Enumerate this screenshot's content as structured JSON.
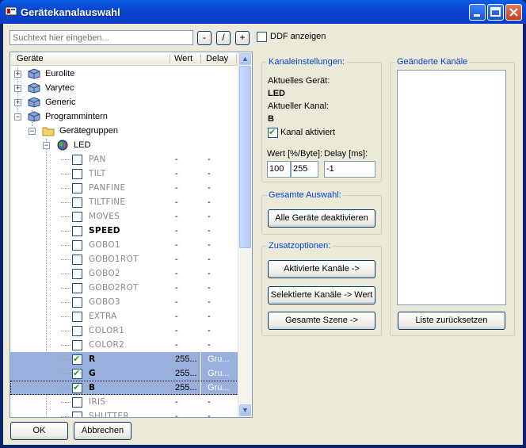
{
  "window": {
    "title": "Gerätekanalauswahl"
  },
  "search": {
    "placeholder": "Suchtext hier eingeben...",
    "btn_minus": "-",
    "btn_slash": "/",
    "btn_plus": "+",
    "ddf_label": "DDF anzeigen",
    "ddf_checked": false
  },
  "tree": {
    "columns": [
      "Geräte",
      "Wert",
      "Delay"
    ],
    "devices": [
      "Eurolite",
      "Varytec",
      "Generic",
      "Programmintern"
    ],
    "subgroup": "Gerätegruppen",
    "device": "LED",
    "channels": [
      {
        "name": "PAN",
        "wert": "-",
        "delay": "-",
        "checked": false,
        "bold": false,
        "selected": false
      },
      {
        "name": "TILT",
        "wert": "-",
        "delay": "-",
        "checked": false,
        "bold": false,
        "selected": false
      },
      {
        "name": "PANFINE",
        "wert": "-",
        "delay": "-",
        "checked": false,
        "bold": false,
        "selected": false
      },
      {
        "name": "TILTFINE",
        "wert": "-",
        "delay": "-",
        "checked": false,
        "bold": false,
        "selected": false
      },
      {
        "name": "MOVES",
        "wert": "-",
        "delay": "-",
        "checked": false,
        "bold": false,
        "selected": false
      },
      {
        "name": "SPEED",
        "wert": "-",
        "delay": "-",
        "checked": false,
        "bold": true,
        "selected": false
      },
      {
        "name": "GOBO1",
        "wert": "-",
        "delay": "-",
        "checked": false,
        "bold": false,
        "selected": false
      },
      {
        "name": "GOBO1ROT",
        "wert": "-",
        "delay": "-",
        "checked": false,
        "bold": false,
        "selected": false
      },
      {
        "name": "GOBO2",
        "wert": "-",
        "delay": "-",
        "checked": false,
        "bold": false,
        "selected": false
      },
      {
        "name": "GOBO2ROT",
        "wert": "-",
        "delay": "-",
        "checked": false,
        "bold": false,
        "selected": false
      },
      {
        "name": "GOBO3",
        "wert": "-",
        "delay": "-",
        "checked": false,
        "bold": false,
        "selected": false
      },
      {
        "name": "EXTRA",
        "wert": "-",
        "delay": "-",
        "checked": false,
        "bold": false,
        "selected": false
      },
      {
        "name": "COLOR1",
        "wert": "-",
        "delay": "-",
        "checked": false,
        "bold": false,
        "selected": false
      },
      {
        "name": "COLOR2",
        "wert": "-",
        "delay": "-",
        "checked": false,
        "bold": false,
        "selected": false
      },
      {
        "name": "R",
        "wert": "255...",
        "delay": "Gru...",
        "checked": true,
        "bold": true,
        "selected": true
      },
      {
        "name": "G",
        "wert": "255...",
        "delay": "Gru...",
        "checked": true,
        "bold": true,
        "selected": true
      },
      {
        "name": "B",
        "wert": "255...",
        "delay": "Gru...",
        "checked": true,
        "bold": true,
        "selected": true
      },
      {
        "name": "IRIS",
        "wert": "-",
        "delay": "-",
        "checked": false,
        "bold": false,
        "selected": false
      },
      {
        "name": "SHUTTER",
        "wert": "-",
        "delay": "-",
        "checked": false,
        "bold": false,
        "selected": false
      }
    ]
  },
  "kanal": {
    "title": "Kanaleinstellungen:",
    "geraet_label": "Aktuelles Gerät:",
    "geraet_value": "LED",
    "kanal_label": "Aktueller Kanal:",
    "kanal_value": "B",
    "aktiviert_label": "Kanal aktiviert",
    "aktiviert": true,
    "wert_label": "Wert [%/Byte]:",
    "delay_label": "Delay [ms]:",
    "wert_pct": "100",
    "wert_byte": "255",
    "delay_value": "-1"
  },
  "gesamt": {
    "title": "Gesamte Auswahl:",
    "btn": "Alle Geräte deaktivieren"
  },
  "zusatz": {
    "title": "Zusatzoptionen:",
    "btn1": "Aktivierte Kanäle ->",
    "btn2": "Selektierte Kanäle -> Wert",
    "btn3": "Gesamte Szene ->"
  },
  "geaendert": {
    "title": "Geänderte Kanäle",
    "reset_btn": "Liste zurücksetzen"
  },
  "footer": {
    "ok": "OK",
    "cancel": "Abbrechen"
  },
  "colors": {
    "selection": "#9ab0dc",
    "group_title": "#0046d5",
    "titlebar": "#0846d1"
  }
}
